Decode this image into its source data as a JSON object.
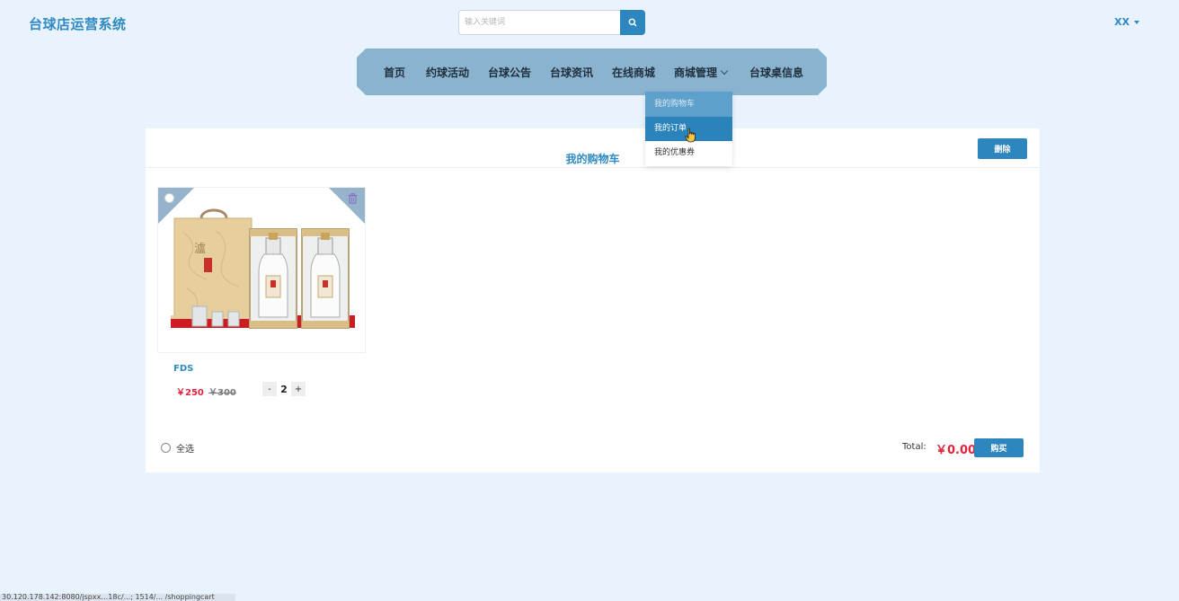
{
  "header": {
    "brand": "台球店运营系统",
    "search_placeholder": "输入关键词",
    "user": "XX"
  },
  "nav": {
    "items": [
      {
        "label": "首页"
      },
      {
        "label": "约球活动"
      },
      {
        "label": "台球公告"
      },
      {
        "label": "台球资讯"
      },
      {
        "label": "在线商城"
      },
      {
        "label": "商城管理"
      },
      {
        "label": "台球桌信息"
      }
    ],
    "dropdown": [
      "我的购物车",
      "我的订单",
      "我的优惠券"
    ]
  },
  "cart": {
    "title": "我的购物车",
    "delete_label": "删除",
    "item": {
      "name": "FDS",
      "price": "￥250",
      "original_price": "￥300",
      "quantity": "2",
      "minus": "-",
      "plus": "+"
    },
    "select_all": "全选",
    "total_label": "Total:",
    "total_value": "￥0.00",
    "buy_label": "购买"
  },
  "status_bar": "30.120.178.142:8080/jspxx…18c/...; 1514/... /shoppingcart"
}
